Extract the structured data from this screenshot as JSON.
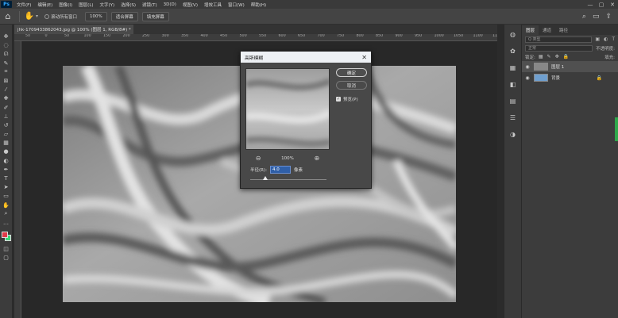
{
  "menubar": {
    "logo": "Ps",
    "items": [
      "文件(F)",
      "编辑(E)",
      "图像(I)",
      "图层(L)",
      "文字(Y)",
      "选择(S)",
      "滤镜(T)",
      "3D(D)",
      "视图(V)",
      "增效工具",
      "窗口(W)",
      "帮助(H)"
    ],
    "controls": [
      "—",
      "▢",
      "✕"
    ]
  },
  "options": {
    "home_icon": "home-icon",
    "tool_icon": "hand-icon",
    "scroll_all_label": "滚动所有窗口",
    "zoom_value": "100%",
    "fit_label": "适合屏幕",
    "fill_label": "填充屏幕"
  },
  "toolbar": {
    "tools": [
      "move-icon",
      "marquee-icon",
      "lasso-icon",
      "quick-select-icon",
      "crop-icon",
      "frame-icon",
      "eyedropper-icon",
      "healing-icon",
      "brush-icon",
      "stamp-icon",
      "history-brush-icon",
      "eraser-icon",
      "gradient-icon",
      "blur-icon",
      "dodge-icon",
      "pen-icon",
      "type-icon",
      "path-select-icon",
      "shape-icon",
      "hand-icon",
      "zoom-icon",
      "more-icon"
    ],
    "foreground_color": "#e13a4a",
    "background_color": "#3ad67a"
  },
  "document": {
    "tab_title": "jhk-1709433862043.jpg @ 100% (图层 1, RGB/8#) *",
    "tab_close": "×",
    "ruler_ticks": [
      "50",
      "0",
      "50",
      "100",
      "150",
      "200",
      "250",
      "300",
      "350",
      "400",
      "450",
      "500",
      "550",
      "600",
      "650",
      "700",
      "750",
      "800",
      "850",
      "900",
      "950",
      "1000",
      "1050",
      "1100",
      "1150"
    ]
  },
  "dialog": {
    "title": "高斯模糊",
    "close": "✕",
    "ok_label": "确定",
    "cancel_label": "取消",
    "preview_label": "预览(P)",
    "preview_checked": true,
    "zoom_level": "100%",
    "radius_label": "半径(R):",
    "radius_value": "4.0",
    "radius_unit": "像素"
  },
  "sidestrip": {
    "icons": [
      "color-wheel-icon",
      "palette-icon",
      "grid-icon",
      "layers-panel-icon",
      "swatches-icon",
      "adjustments-icon",
      "circle-half-icon"
    ]
  },
  "panel": {
    "tabs": [
      "图层",
      "通道",
      "路径"
    ],
    "active_tab": 0,
    "search_placeholder": "Q 类型",
    "blend_mode": "正常",
    "opacity_label": "不透明度:",
    "lock_label": "锁定:",
    "fill_label": "填充:",
    "layers": [
      {
        "name": "图层 1",
        "selected": true,
        "locked": false
      },
      {
        "name": "背景",
        "selected": false,
        "locked": true
      }
    ]
  }
}
